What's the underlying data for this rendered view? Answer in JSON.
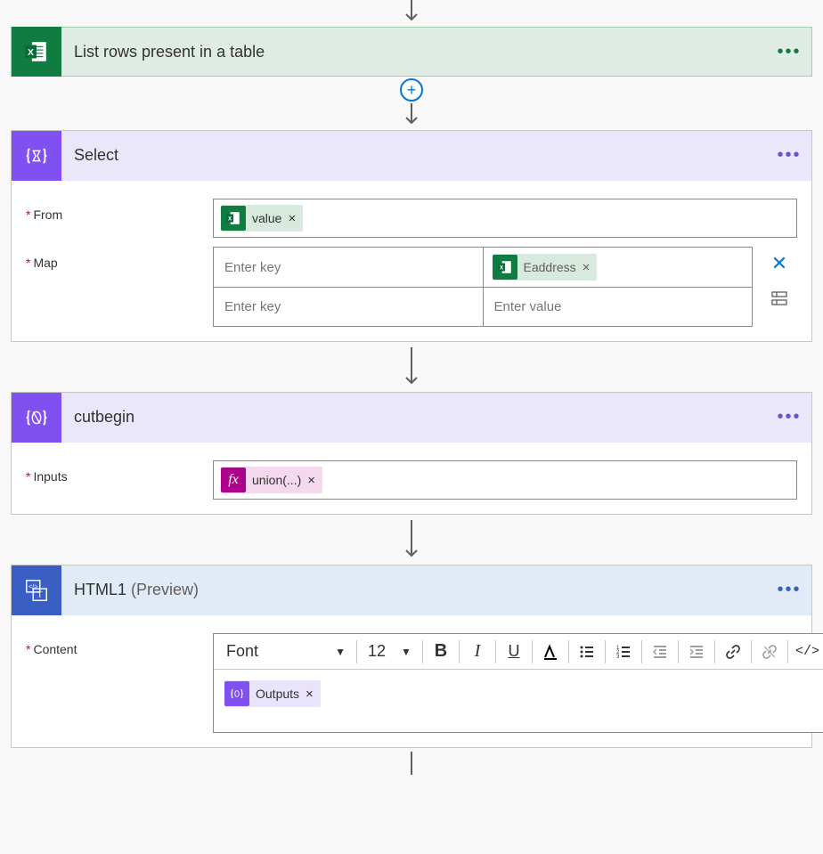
{
  "steps": {
    "excel": {
      "title": "List rows present in a table"
    },
    "select": {
      "title": "Select",
      "from_label": "From",
      "map_label": "Map",
      "from_token": "value",
      "map_rows": [
        {
          "key_placeholder": "Enter key",
          "value_token": "Eaddress"
        },
        {
          "key_placeholder": "Enter key",
          "value_placeholder": "Enter value"
        }
      ]
    },
    "cutbegin": {
      "title": "cutbegin",
      "inputs_label": "Inputs",
      "fx_token": "union(...)"
    },
    "html": {
      "title": "HTML1",
      "subtitle": "(Preview)",
      "content_label": "Content",
      "outputs_token": "Outputs",
      "toolbar": {
        "font": "Font",
        "size": "12"
      }
    }
  }
}
